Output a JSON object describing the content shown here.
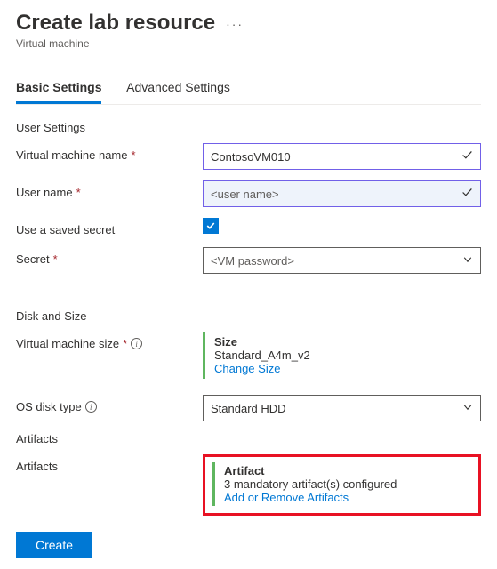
{
  "header": {
    "title": "Create lab resource",
    "subtitle": "Virtual machine",
    "more_icon": "···"
  },
  "tabs": {
    "basic": "Basic Settings",
    "advanced": "Advanced Settings"
  },
  "sections": {
    "user_settings": "User Settings",
    "disk_size": "Disk and Size",
    "artifacts": "Artifacts"
  },
  "fields": {
    "vm_name": {
      "label": "Virtual machine name",
      "value": "ContosoVM010",
      "required": "*"
    },
    "user_name": {
      "label": "User name",
      "placeholder": "<user name>",
      "required": "*"
    },
    "use_secret": {
      "label": "Use a saved secret"
    },
    "secret": {
      "label": "Secret",
      "placeholder": "<VM password>",
      "required": "*"
    },
    "vm_size": {
      "label": "Virtual machine size",
      "required": "*",
      "heading": "Size",
      "value": "Standard_A4m_v2",
      "link": "Change Size"
    },
    "os_disk": {
      "label": "OS disk type",
      "value": "Standard HDD"
    },
    "artifacts": {
      "label": "Artifacts",
      "heading": "Artifact",
      "summary": "3 mandatory artifact(s) configured",
      "link": "Add or Remove Artifacts"
    }
  },
  "footer": {
    "create": "Create"
  }
}
